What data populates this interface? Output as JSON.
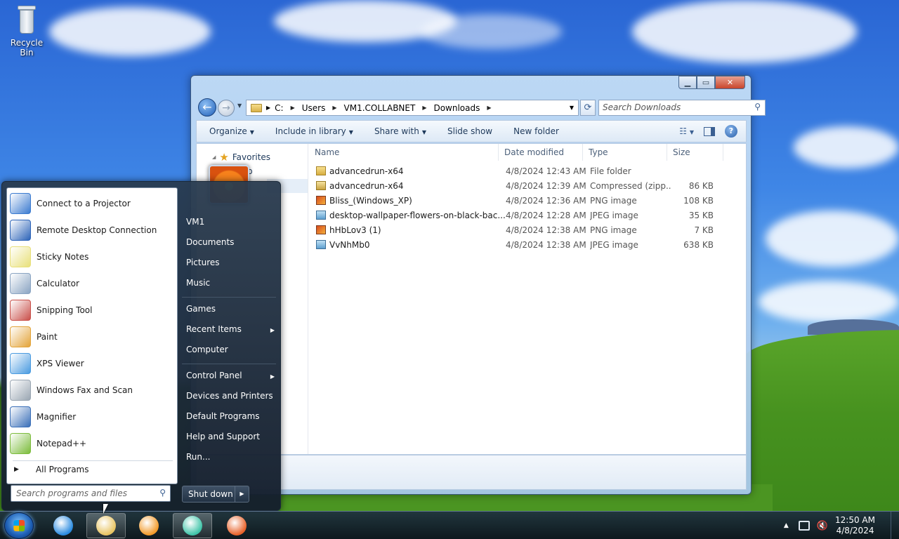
{
  "desktop": {
    "icons": [
      {
        "label": "Recycle Bin",
        "icon": "recycle-bin-icon"
      }
    ]
  },
  "explorer": {
    "address": {
      "crumbs": [
        "C:",
        "Users",
        "VM1.COLLABNET",
        "Downloads"
      ]
    },
    "search_placeholder": "Search Downloads",
    "toolbar": {
      "organize": "Organize",
      "include_in_library": "Include in library",
      "share_with": "Share with",
      "slide_show": "Slide show",
      "new_folder": "New folder"
    },
    "nav": {
      "favorites": "Favorites",
      "desktop_partial": "top"
    },
    "columns": {
      "name": "Name",
      "date_modified": "Date modified",
      "type": "Type",
      "size": "Size"
    },
    "files": [
      {
        "name": "advancedrun-x64",
        "date": "4/8/2024 12:43 AM",
        "type": "File folder",
        "size": "",
        "icon": "folder"
      },
      {
        "name": "advancedrun-x64",
        "date": "4/8/2024 12:39 AM",
        "type": "Compressed (zipp...",
        "size": "86 KB",
        "icon": "zip"
      },
      {
        "name": "Bliss_(Windows_XP)",
        "date": "4/8/2024 12:36 AM",
        "type": "PNG image",
        "size": "108 KB",
        "icon": "png"
      },
      {
        "name": "desktop-wallpaper-flowers-on-black-bac...",
        "date": "4/8/2024 12:28 AM",
        "type": "JPEG image",
        "size": "35 KB",
        "icon": "jpg"
      },
      {
        "name": "hHbLov3 (1)",
        "date": "4/8/2024 12:38 AM",
        "type": "PNG image",
        "size": "7 KB",
        "icon": "png"
      },
      {
        "name": "VvNhMb0",
        "date": "4/8/2024 12:38 AM",
        "type": "JPEG image",
        "size": "638 KB",
        "icon": "jpg"
      }
    ]
  },
  "start_menu": {
    "programs": [
      {
        "label": "Connect to a Projector",
        "icon": "projector-icon",
        "color": "#3b7bd0"
      },
      {
        "label": "Remote Desktop Connection",
        "icon": "remote-desktop-icon",
        "color": "#2d64b8"
      },
      {
        "label": "Sticky Notes",
        "icon": "sticky-notes-icon",
        "color": "#e8e07a"
      },
      {
        "label": "Calculator",
        "icon": "calculator-icon",
        "color": "#8aa4c2"
      },
      {
        "label": "Snipping Tool",
        "icon": "snipping-tool-icon",
        "color": "#c9504a"
      },
      {
        "label": "Paint",
        "icon": "paint-icon",
        "color": "#e3a43a"
      },
      {
        "label": "XPS Viewer",
        "icon": "xps-viewer-icon",
        "color": "#4a9be0"
      },
      {
        "label": "Windows Fax and Scan",
        "icon": "fax-scan-icon",
        "color": "#9aa6b2"
      },
      {
        "label": "Magnifier",
        "icon": "magnifier-icon",
        "color": "#3a6fb8"
      },
      {
        "label": "Notepad++",
        "icon": "notepadpp-icon",
        "color": "#7cbc3c"
      }
    ],
    "all_programs": "All Programs",
    "search_placeholder": "Search programs and files",
    "right": {
      "user": "VM1",
      "documents": "Documents",
      "pictures": "Pictures",
      "music": "Music",
      "games": "Games",
      "recent_items": "Recent Items",
      "computer": "Computer",
      "control_panel": "Control Panel",
      "devices_printers": "Devices and Printers",
      "default_programs": "Default Programs",
      "help_support": "Help and Support",
      "run": "Run..."
    },
    "shut_down": "Shut down"
  },
  "taskbar": {
    "apps": [
      {
        "name": "internet-explorer-icon",
        "color": "#2a8be0"
      },
      {
        "name": "windows-explorer-icon",
        "color": "#e8c462"
      },
      {
        "name": "media-player-icon",
        "color": "#f29a2a"
      },
      {
        "name": "network-app-icon",
        "color": "#3fc4a8"
      },
      {
        "name": "firefox-icon",
        "color": "#e8622a"
      }
    ],
    "clock": {
      "time": "12:50 AM",
      "date": "4/8/2024"
    }
  }
}
